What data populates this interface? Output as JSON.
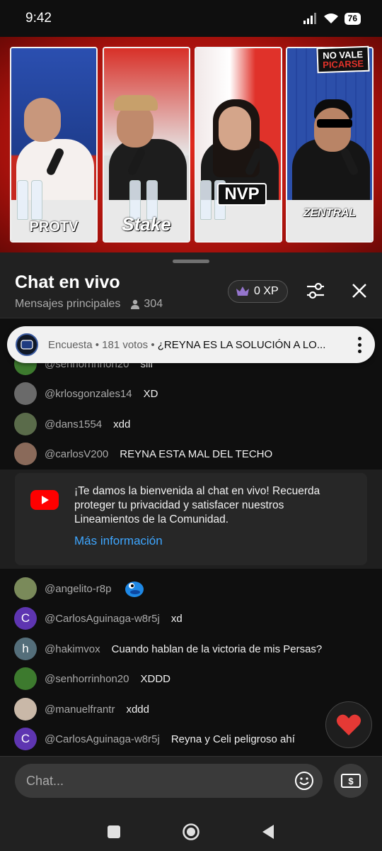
{
  "status_bar": {
    "time": "9:42",
    "battery": "76"
  },
  "video": {
    "panels": [
      {
        "logo": "PROTV"
      },
      {
        "logo": "Stake"
      },
      {
        "logo": "NVP"
      },
      {
        "logo": "ZENTRAL"
      }
    ],
    "corner_logo": "NO VALE\nPICARSE"
  },
  "chat": {
    "title": "Chat en vivo",
    "subtitle": "Mensajes principales",
    "viewers": "304",
    "xp": "0 XP",
    "poll": {
      "meta": "Encuesta • 181 votos • ",
      "question": "¿REYNA ES LA SOLUCIÓN A LO..."
    },
    "messages_top": [
      {
        "user": "@senhorrinhon20",
        "text": "siii",
        "avatar_color": "#3d7a2e"
      },
      {
        "user": "@krlosgonzales14",
        "text": "XD",
        "avatar_color": "#6a6a6a"
      },
      {
        "user": "@dans1554",
        "text": "xdd",
        "avatar_color": "#5a6b4a"
      },
      {
        "user": "@carlosV200",
        "text": "REYNA ESTA MAL DEL TECHO",
        "avatar_color": "#8a6a5a"
      }
    ],
    "welcome": {
      "text": "¡Te damos la bienvenida al chat en vivo! Recuerda proteger tu privacidad y satisfacer nuestros Lineamientos de la Comunidad.",
      "link": "Más información"
    },
    "messages_bottom": [
      {
        "user": "@angelito-r8p",
        "text": "",
        "avatar_color": "#7a8a5a",
        "initial": ""
      },
      {
        "user": "@CarlosAguinaga-w8r5j",
        "text": "xd",
        "avatar_color": "#5e35b1",
        "initial": "C"
      },
      {
        "user": "@hakimvox",
        "text": "Cuando hablan de la victoria de mis Persas?",
        "avatar_color": "#546e7a",
        "initial": "h"
      },
      {
        "user": "@senhorrinhon20",
        "text": "XDDD",
        "avatar_color": "#3d7a2e",
        "initial": ""
      },
      {
        "user": "@manuelfrantr",
        "text": "xddd",
        "avatar_color": "#c9b8a8",
        "initial": ""
      },
      {
        "user": "@CarlosAguinaga-w8r5j",
        "text": "Reyna y Celi peligroso ahí",
        "avatar_color": "#5e35b1",
        "initial": "C"
      }
    ],
    "input_placeholder": "Chat..."
  },
  "colors": {
    "accent_link": "#3ea6ff",
    "youtube_red": "#ff0000",
    "heart": "#e53935"
  }
}
